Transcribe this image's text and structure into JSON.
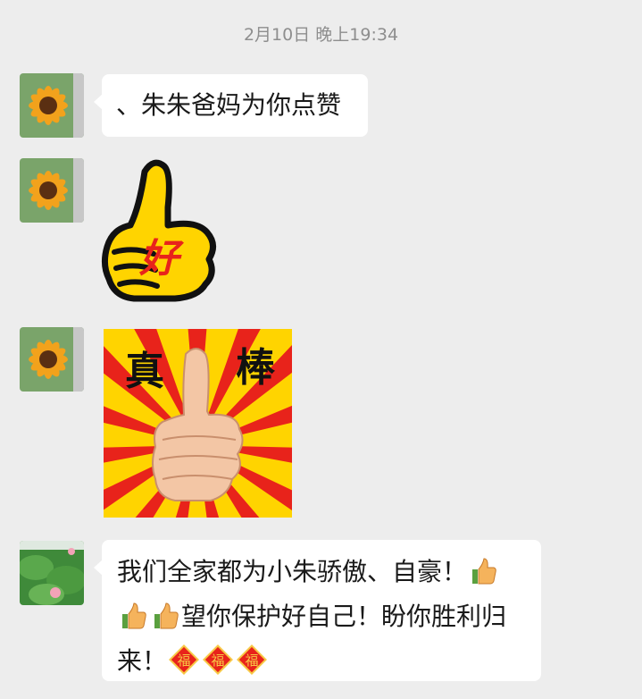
{
  "timestamp": "2月10日 晚上19:34",
  "messages": [
    {
      "type": "text",
      "text": "、朱朱爸妈为你点赞"
    },
    {
      "type": "sticker",
      "sticker": "thumbs-up-hao-sticker",
      "text": "好"
    },
    {
      "type": "sticker",
      "sticker": "zhen-bang-thumbs-up-sticker",
      "text_left": "真",
      "text_right": "棒"
    },
    {
      "type": "text",
      "line1": "我们全家都为小朱骄傲、自豪！",
      "line2": "望你保护好自己！盼你胜利归",
      "line3": "来！",
      "emojis": [
        "thumbs-up",
        "thumbs-up",
        "thumbs-up",
        "fu-diamond",
        "fu-diamond",
        "fu-diamond"
      ],
      "fu_char": "福"
    }
  ],
  "colors": {
    "background": "#ededed",
    "bubble": "#ffffff",
    "timestamp": "#8e8e8e",
    "sticker_yellow": "#ffd400",
    "sticker_red": "#e8231b"
  }
}
